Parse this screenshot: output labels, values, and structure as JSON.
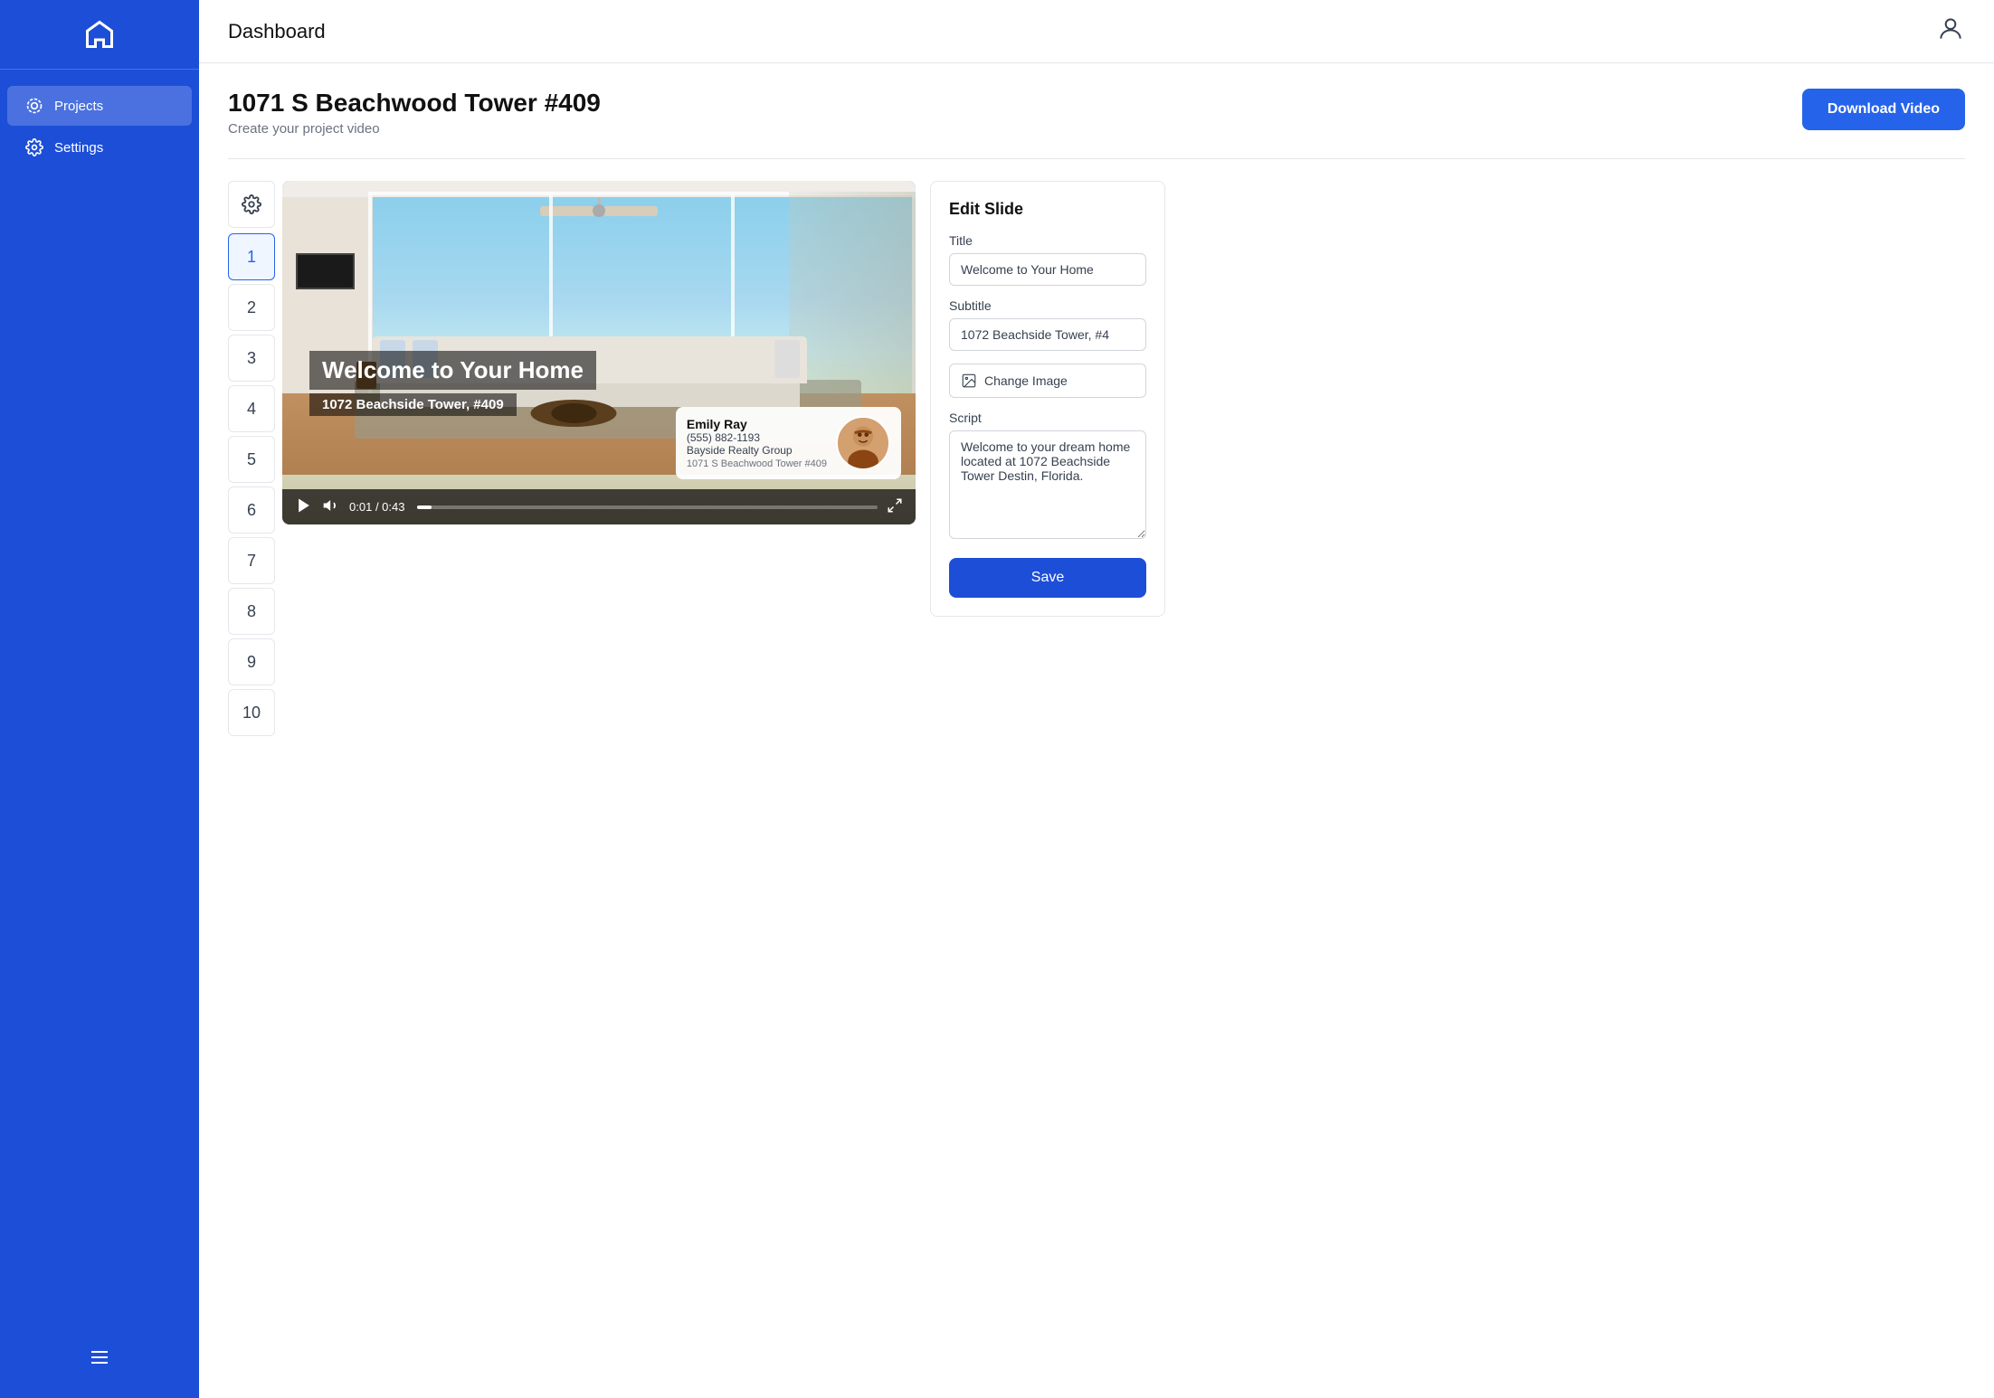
{
  "sidebar": {
    "logo_label": "Home",
    "items": [
      {
        "id": "projects",
        "label": "Projects",
        "active": true
      },
      {
        "id": "settings",
        "label": "Settings",
        "active": false
      }
    ],
    "menu_icon": "menu-icon"
  },
  "header": {
    "title": "Dashboard",
    "avatar_icon": "user-icon"
  },
  "project": {
    "title": "1071 S Beachwood Tower #409",
    "subtitle": "Create your project video",
    "download_button_label": "Download Video"
  },
  "slides": {
    "numbers": [
      "1",
      "2",
      "3",
      "4",
      "5",
      "6",
      "7",
      "8",
      "9",
      "10"
    ],
    "active_slide": "1"
  },
  "video": {
    "overlay_title": "Welcome to Your Home",
    "overlay_subtitle": "1072 Beachside Tower, #409",
    "time_current": "0:01",
    "time_total": "0:43",
    "agent": {
      "name": "Emily Ray",
      "phone": "(555) 882-1193",
      "company": "Bayside Realty Group",
      "address": "1071 S Beachwood Tower #409"
    }
  },
  "edit_panel": {
    "title": "Edit Slide",
    "title_label": "Title",
    "title_value": "Welcome to Your Home",
    "subtitle_label": "Subtitle",
    "subtitle_value": "1072 Beachside Tower, #4",
    "change_image_label": "Change Image",
    "script_label": "Script",
    "script_value": "Welcome to your dream home located at 1072 Beachside Tower Destin, Florida.",
    "save_button_label": "Save"
  }
}
